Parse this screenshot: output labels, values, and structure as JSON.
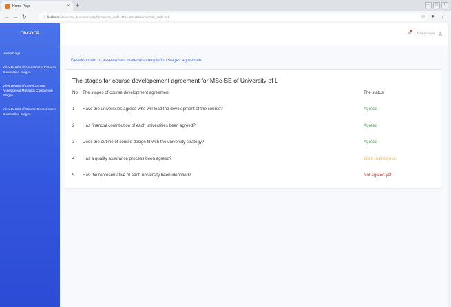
{
  "browser": {
    "tab_title": "Home Page",
    "tab_close": "×",
    "new_tab": "+",
    "url_host": "localhost",
    "url_path": "/cb/course_development.php?course_code=MSc-SE%20&university_code=UL"
  },
  "sidebar": {
    "brand": "CBCOCP",
    "items": [
      {
        "label": "Home Page"
      },
      {
        "label": "View Deatils of Assessment Process Completion Stages"
      },
      {
        "label": "View Deatils of Development Assessment Materials Completion Stages"
      },
      {
        "label": "View Deatils of Course Development Completion Stages"
      }
    ]
  },
  "header": {
    "user_name": "Mas Abrayen"
  },
  "card": {
    "breadcrumb": "Development of assessment materials completion stages agreement",
    "heading": "The stages for course developement agreement for MSc-SE of University of L",
    "columns": [
      "No.",
      "The stages of course development agreement",
      "The status"
    ],
    "rows": [
      {
        "no": "1",
        "stage": "Have the universities agreed who will lead the development of the course?",
        "status": "Agreed",
        "status_color": "#5fa55a"
      },
      {
        "no": "2",
        "stage": "Has financial contribution of each universities been agreed?",
        "status": "Agreed",
        "status_color": "#5fa55a"
      },
      {
        "no": "3",
        "stage": "Does the outline of course design fit with the university strategy?",
        "status": "Agreed",
        "status_color": "#5fa55a"
      },
      {
        "no": "4",
        "stage": "Has a quality assurance process been agreed?",
        "status": "Work in progress.",
        "status_color": "#f0b44c"
      },
      {
        "no": "5",
        "stage": "Has the representative of each university been identified?",
        "status": "Not agreed yet!",
        "status_color": "#d33c3c"
      }
    ]
  },
  "colors": {
    "sidebar": "#3457df",
    "accent": "#4e73df",
    "agreed": "#5fa55a",
    "in_progress": "#f0b44c",
    "not_agreed": "#d33c3c"
  }
}
